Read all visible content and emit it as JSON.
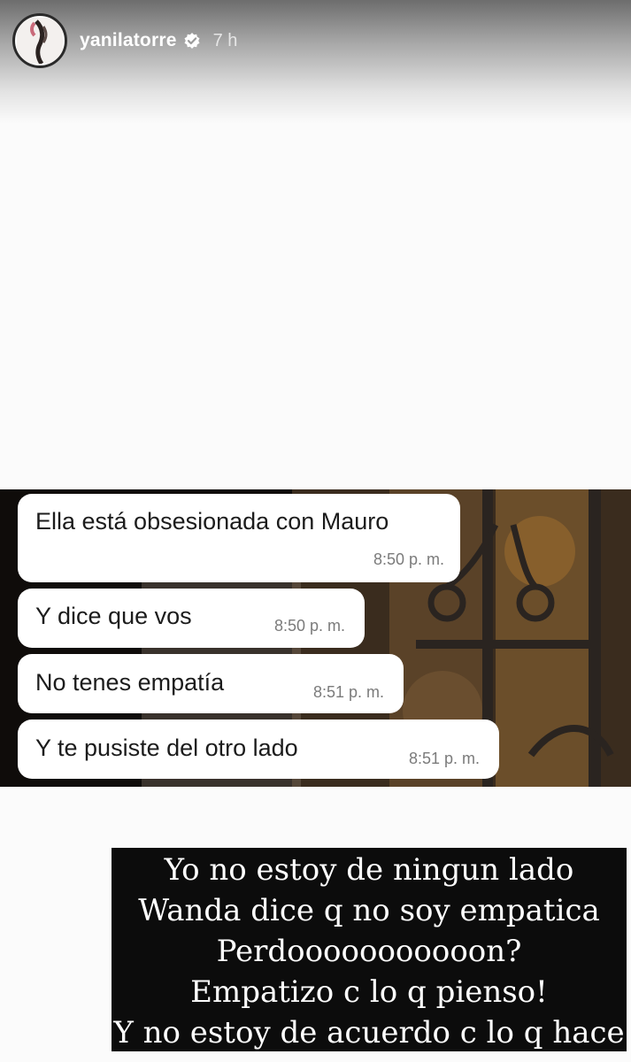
{
  "header": {
    "username": "yanilatorre",
    "time_ago": "7 h",
    "icons": {
      "avatar": "profile-avatar",
      "verified": "verified-badge-icon"
    }
  },
  "messages": [
    {
      "text": "Ella está obsesionada con Mauro",
      "time": "8:50 p. m."
    },
    {
      "text": "Y dice que vos",
      "time": "8:50 p. m."
    },
    {
      "text": "No tenes empatía",
      "time": "8:51 p. m."
    },
    {
      "text": "Y te pusiste del otro lado",
      "time": "8:51 p. m."
    }
  ],
  "caption": {
    "lines": [
      "Yo no estoy de ningun lado",
      "Wanda dice q no soy empatica",
      "Perdooooooooooon?",
      "Empatizo c lo q pienso!",
      "Y no estoy de acuerdo c lo q hace"
    ]
  },
  "colors": {
    "caption_background": "#0c0c0c",
    "bubble_background": "#ffffff",
    "timestamp_text": "#7b7b7b"
  }
}
